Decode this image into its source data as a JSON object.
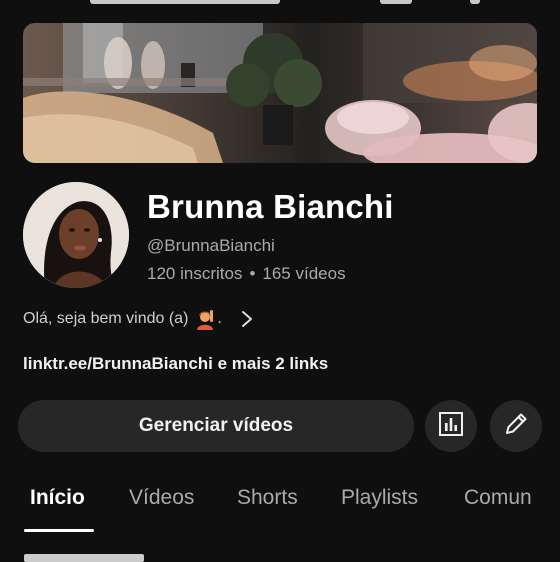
{
  "channel": {
    "name": "Brunna Bianchi",
    "handle": "@BrunnaBianchi",
    "subscribers": "120 inscritos",
    "separator": "•",
    "videos": "165 vídeos",
    "description": "Olá, seja bem vindo (a)",
    "description_end": ".",
    "links": "linktr.ee/BrunnaBianchi e mais 2 links"
  },
  "actions": {
    "manage_videos_label": "Gerenciar vídeos"
  },
  "tabs": [
    {
      "label": "Início",
      "active": true
    },
    {
      "label": "Vídeos",
      "active": false
    },
    {
      "label": "Shorts",
      "active": false
    },
    {
      "label": "Playlists",
      "active": false
    },
    {
      "label": "Comun",
      "active": false
    }
  ],
  "icons": {
    "analytics": "analytics-icon",
    "edit": "pencil-icon",
    "chevron": "chevron-right-icon",
    "emoji": "person-raising-hand-emoji"
  },
  "colors": {
    "background": "#0f0f0f",
    "button_bg": "#272727",
    "text_primary": "#f1f1f1",
    "text_secondary": "#aaaaaa"
  }
}
